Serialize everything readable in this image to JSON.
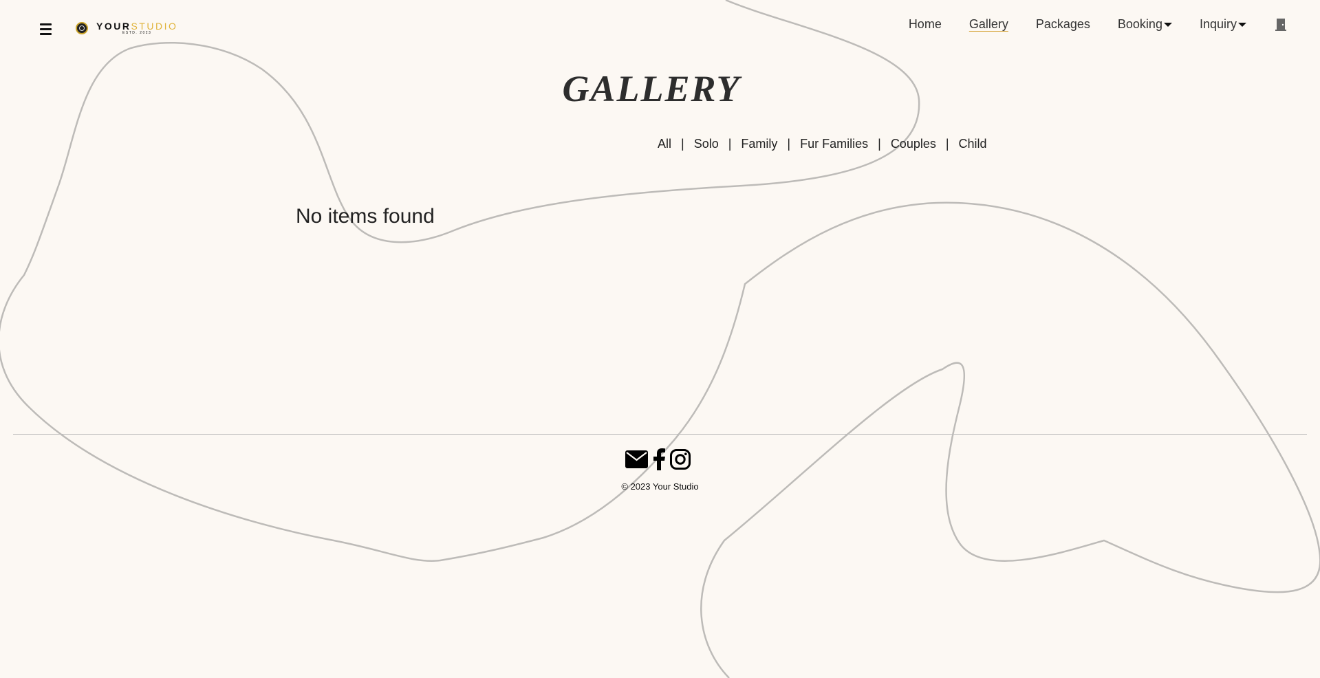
{
  "brand": {
    "word_your": "YOUR",
    "word_studio": "STUDIO",
    "tagline": "ESTD. 2023",
    "logo_icon": "camera-aperture-icon",
    "colors": {
      "accent": "#e0b43c",
      "background": "#fcf8f3",
      "curve": "#bdbbb8"
    }
  },
  "nav": {
    "menu_icon": "hamburger-menu-icon",
    "items": [
      {
        "label": "Home"
      },
      {
        "label": "Gallery",
        "active": true
      },
      {
        "label": "Packages"
      },
      {
        "label": "Booking"
      },
      {
        "label": "Inquiry"
      }
    ],
    "exit_icon": "door-exit-icon"
  },
  "gallery": {
    "title": "GALLERY",
    "filters": [
      "All",
      "Solo",
      "Family",
      "Fur Families",
      "Couples",
      "Child"
    ],
    "separator": "|",
    "empty_message": "No items found"
  },
  "footer": {
    "icons": [
      "envelope-icon",
      "facebook-icon",
      "instagram-icon"
    ],
    "copyright": "© 2023 Your Studio"
  }
}
